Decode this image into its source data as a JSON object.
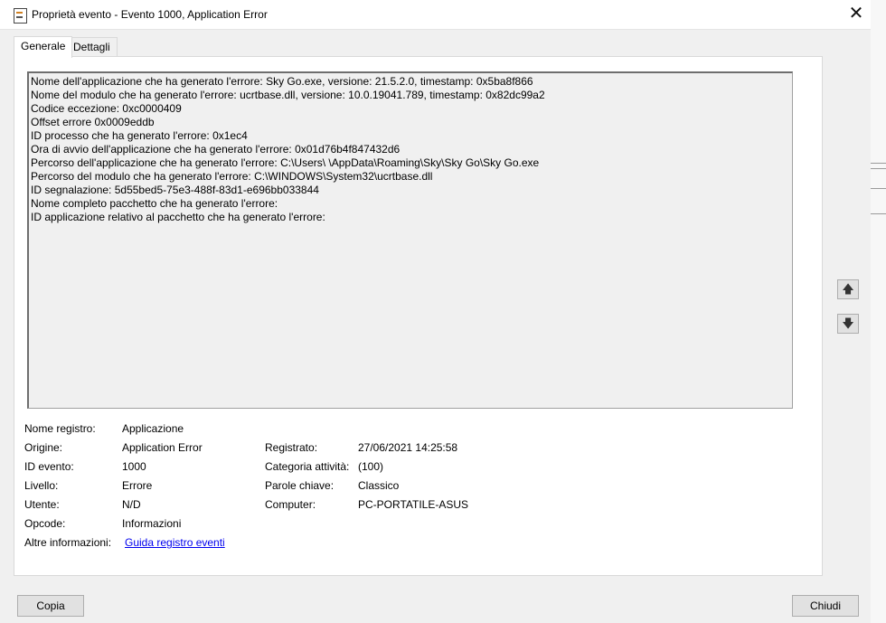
{
  "window": {
    "title": "Proprietà evento - Evento 1000, Application Error",
    "close_glyph": "✕"
  },
  "tabs": [
    {
      "label": "Generale"
    },
    {
      "label": "Dettagli"
    }
  ],
  "description_lines": [
    "Nome dell'applicazione che ha generato l'errore: Sky Go.exe, versione: 21.5.2.0, timestamp: 0x5ba8f866",
    "Nome del modulo che ha generato l'errore: ucrtbase.dll, versione: 10.0.19041.789, timestamp: 0x82dc99a2",
    "Codice eccezione: 0xc0000409",
    "Offset errore 0x0009eddb",
    "ID processo che ha generato l'errore: 0x1ec4",
    "Ora di avvio dell'applicazione che ha generato l'errore: 0x01d76b4f847432d6",
    "Percorso dell'applicazione che ha generato l'errore: C:\\Users\\        \\AppData\\Roaming\\Sky\\Sky Go\\Sky Go.exe",
    "Percorso del modulo che ha generato l'errore: C:\\WINDOWS\\System32\\ucrtbase.dll",
    "ID segnalazione: 5d55bed5-75e3-488f-83d1-e696bb033844",
    "Nome completo pacchetto che ha generato l'errore:",
    "ID applicazione relativo al pacchetto che ha generato l'errore:"
  ],
  "fields": {
    "log_name": {
      "label": "Nome registro:",
      "value": "Applicazione"
    },
    "source": {
      "label": "Origine:",
      "value": "Application Error"
    },
    "logged": {
      "label": "Registrato:",
      "value": "27/06/2021 14:25:58"
    },
    "event_id": {
      "label": "ID evento:",
      "value": "1000"
    },
    "task_category": {
      "label": "Categoria attività:",
      "value": "(100)"
    },
    "level": {
      "label": "Livello:",
      "value": "Errore"
    },
    "keywords": {
      "label": "Parole chiave:",
      "value": "Classico"
    },
    "user": {
      "label": "Utente:",
      "value": "N/D"
    },
    "computer": {
      "label": "Computer:",
      "value": "PC-PORTATILE-ASUS"
    },
    "opcode": {
      "label": "Opcode:",
      "value": "Informazioni"
    },
    "more_info": {
      "label": "Altre informazioni:",
      "value": "Guida registro eventi"
    }
  },
  "buttons": {
    "copy": "Copia",
    "close": "Chiudi",
    "up_glyph": "🡅",
    "down_glyph": "🡇"
  }
}
